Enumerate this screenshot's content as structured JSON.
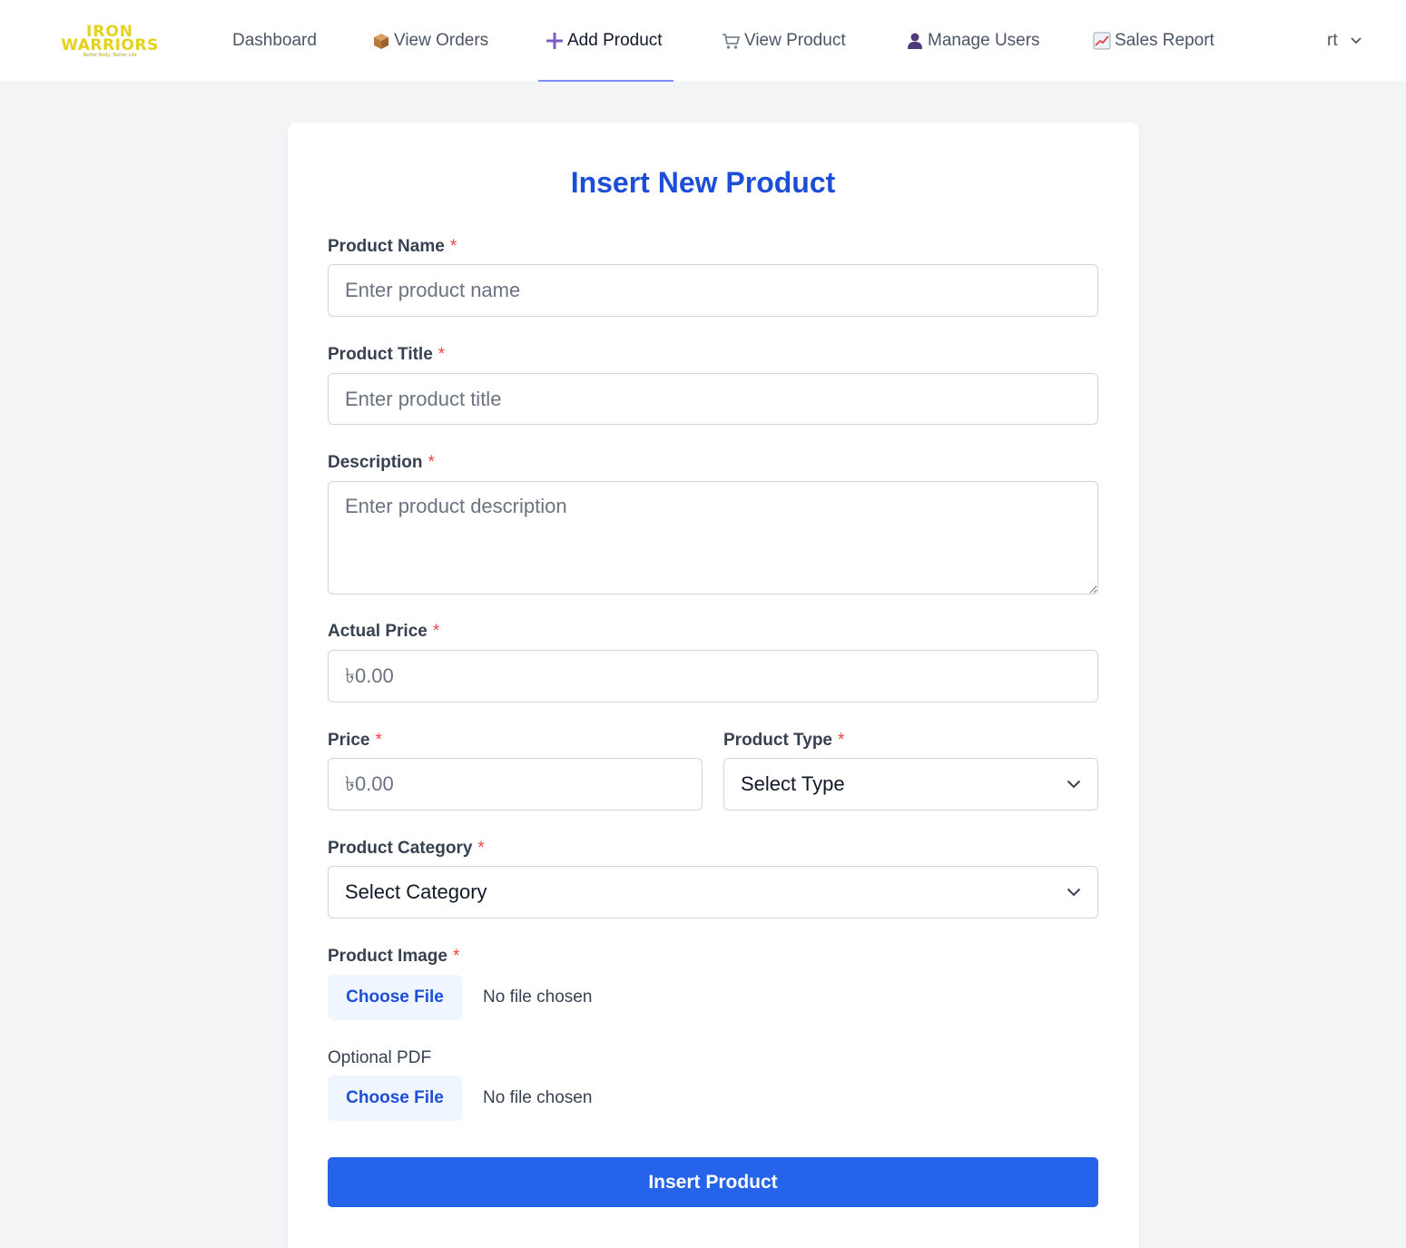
{
  "brand": {
    "name_line1": "IRON",
    "name_line2": "WARRIORS",
    "tagline": "Better Body, Better Life",
    "color": "#e6d21e"
  },
  "nav": {
    "items": [
      {
        "label": "Dashboard",
        "icon": "none"
      },
      {
        "label": "View Orders",
        "icon": "package-icon"
      },
      {
        "label": "Add Product",
        "icon": "plus-icon",
        "active": true
      },
      {
        "label": "View Product",
        "icon": "cart-icon"
      },
      {
        "label": "Manage Users",
        "icon": "user-icon"
      },
      {
        "label": "Sales Report",
        "icon": "chart-increasing-icon"
      }
    ],
    "user": "rt",
    "accent": "#818cf8"
  },
  "form": {
    "title": "Insert New Product",
    "required_mark": "*",
    "product_name": {
      "label": "Product Name",
      "placeholder": "Enter product name"
    },
    "product_title": {
      "label": "Product Title",
      "placeholder": "Enter product title"
    },
    "description": {
      "label": "Description",
      "placeholder": "Enter product description"
    },
    "actual_price": {
      "label": "Actual Price",
      "placeholder": "৳0.00"
    },
    "price": {
      "label": "Price",
      "placeholder": "৳0.00"
    },
    "product_type": {
      "label": "Product Type",
      "value": "Select Type"
    },
    "product_category": {
      "label": "Product Category",
      "value": "Select Category"
    },
    "product_image": {
      "label": "Product Image",
      "button": "Choose File",
      "status": "No file chosen"
    },
    "optional_pdf": {
      "label": "Optional PDF",
      "button": "Choose File",
      "status": "No file chosen"
    },
    "submit_label": "Insert Product",
    "title_color": "#1d4ed8",
    "submit_color": "#2563eb",
    "required_color": "#ef4444"
  }
}
